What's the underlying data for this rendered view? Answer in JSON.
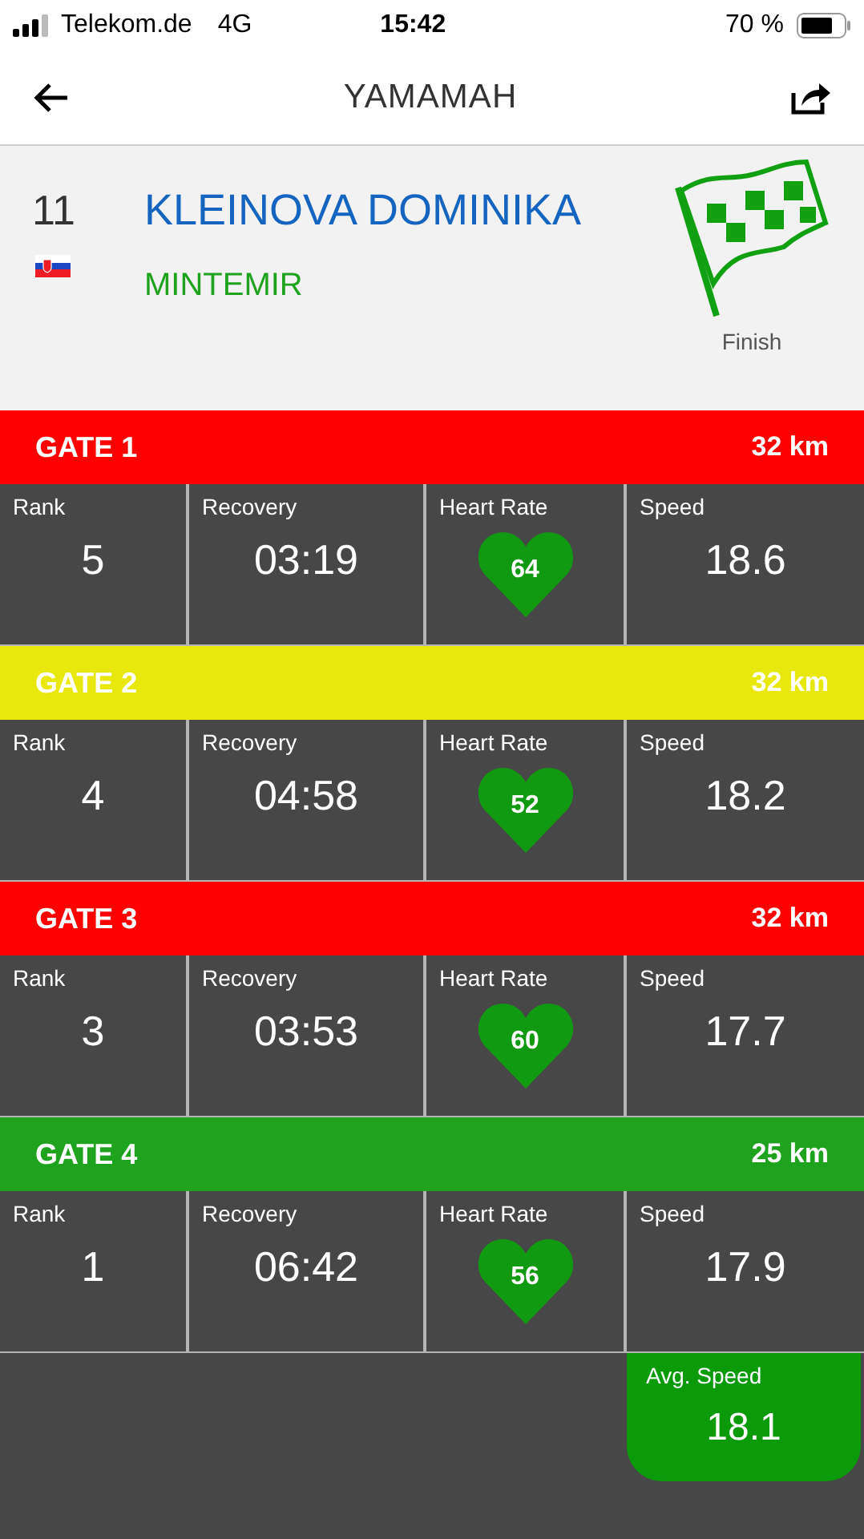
{
  "status_bar": {
    "carrier": "Telekom.de",
    "network": "4G",
    "time": "15:42",
    "battery": "70 %"
  },
  "nav": {
    "title": "YAMAMAH"
  },
  "athlete": {
    "number": "11",
    "name": "KLEINOVA DOMINIKA",
    "horse": "MINTEMIR",
    "status": "Finish"
  },
  "gates": [
    {
      "name": "GATE 1",
      "distance": "32 km",
      "color": "#ff0000",
      "rank_label": "Rank",
      "rank": "5",
      "recovery_label": "Recovery",
      "recovery": "03:19",
      "heart_label": "Heart Rate",
      "heart_rate": "64",
      "speed_label": "Speed",
      "speed": "18.6"
    },
    {
      "name": "GATE 2",
      "distance": "32 km",
      "color": "#e8e80c",
      "rank_label": "Rank",
      "rank": "4",
      "recovery_label": "Recovery",
      "recovery": "04:58",
      "heart_label": "Heart Rate",
      "heart_rate": "52",
      "speed_label": "Speed",
      "speed": "18.2"
    },
    {
      "name": "GATE 3",
      "distance": "32 km",
      "color": "#ff0000",
      "rank_label": "Rank",
      "rank": "3",
      "recovery_label": "Recovery",
      "recovery": "03:53",
      "heart_label": "Heart Rate",
      "heart_rate": "60",
      "speed_label": "Speed",
      "speed": "17.7"
    },
    {
      "name": "GATE 4",
      "distance": "25 km",
      "color": "#1fa31f",
      "rank_label": "Rank",
      "rank": "1",
      "recovery_label": "Recovery",
      "recovery": "06:42",
      "heart_label": "Heart Rate",
      "heart_rate": "56",
      "speed_label": "Speed",
      "speed": "17.9"
    }
  ],
  "avg_speed": {
    "label": "Avg. Speed",
    "value": "18.1"
  }
}
